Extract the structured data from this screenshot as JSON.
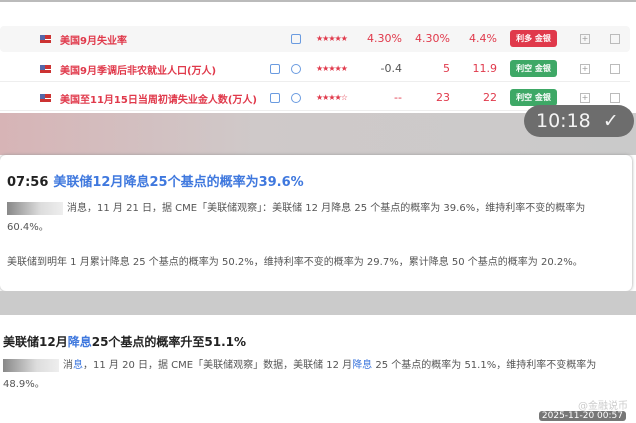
{
  "events": [
    {
      "name": "美国9月失业率",
      "stars": "★★★★★",
      "prev": "4.30%",
      "forecast": "4.30%",
      "actual": "4.4%",
      "badge": "利多 金银",
      "badge_color": "#e0394b",
      "icons": [
        "cube-icon"
      ]
    },
    {
      "name": "美国9月季调后非农就业人口(万人)",
      "stars": "★★★★★",
      "prev": "-0.4",
      "forecast": "5",
      "actual": "11.9",
      "badge": "利空 金银",
      "badge_color": "#3ea866",
      "icons": [
        "cube-icon",
        "target-icon"
      ]
    },
    {
      "name": "美国至11月15日当周初请失业金人数(万人)",
      "stars": "★★★★☆",
      "prev": "--",
      "forecast": "23",
      "actual": "22",
      "badge": "利空 金银",
      "badge_color": "#3ea866",
      "icons": [
        "cube-icon",
        "target-icon"
      ]
    }
  ],
  "pill_time": "10:18",
  "news1": {
    "time": "07:56",
    "title": "美联储12月降息25个基点的概率为39.6%",
    "p1": "消息，11 月 21 日，据 CME「美联储观察」：美联储 12 月降息 25 个基点的概率为 39.6%，维持利率不变的概率为 60.4%。",
    "p2": "美联储到明年 1 月累计降息 25 个基点的概率为 50.2%，维持利率不变的概率为 29.7%，累计降息 50 个基点的概率为 20.2%。"
  },
  "news2": {
    "title_a": "美联储12月",
    "title_link": "降息",
    "title_b": "25个基点的概率升至51.1%",
    "p_a": "消",
    "p_link1": "息",
    "p_b": "，11 月 20 日，据 CME「美联储观察」数据，美联储 12 月",
    "p_link2": "降息",
    "p_c": " 25 个基点的概率为 51.1%，维持利率不变概率为 48.9%。"
  },
  "watermark": "@金融说币",
  "timestamp": "2025-11-20 00:57"
}
